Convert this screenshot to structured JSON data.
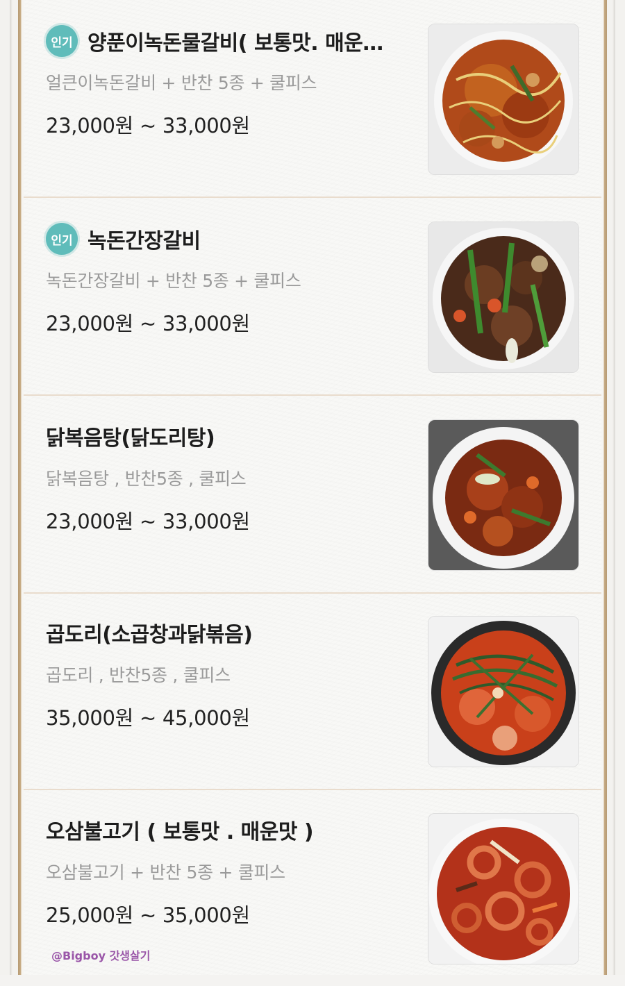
{
  "menu_items": [
    {
      "badge": "인기",
      "name": "양푼이녹돈물갈비( 보통맛. 매운…",
      "description": "얼큰이녹돈갈비 + 반찬 5종 + 쿨피스",
      "price": "23,000원 ~ 33,000원",
      "image": "spicy-pork-rib-stew-photo"
    },
    {
      "badge": "인기",
      "name": "녹돈간장갈비",
      "description": "녹돈간장갈비 + 반찬 5종 + 쿨피스",
      "price": "23,000원 ~ 33,000원",
      "image": "soy-sauce-pork-rib-photo"
    },
    {
      "name": "닭복음탕(닭도리탕)",
      "description": "닭복음탕 , 반찬5종  , 쿨피스",
      "price": "23,000원 ~ 33,000원",
      "image": "braised-spicy-chicken-photo"
    },
    {
      "name": "곱도리(소곱창과닭볶음)",
      "description": "곱도리 ,  반찬5종  , 쿨피스",
      "price": "35,000원 ~ 45,000원",
      "image": "beef-tripe-chicken-stir-fry-photo"
    },
    {
      "name": "오삼불고기 ( 보통맛 . 매운맛 )",
      "description": "오삼불고기 + 반찬 5종 + 쿨피스",
      "price": "25,000원 ~ 35,000원",
      "image": "squid-pork-bulgogi-photo"
    }
  ],
  "watermark": "@Bigboy 갓생살기",
  "colors": {
    "badge": "#5fbcba",
    "frame": "#c9ad86",
    "divider": "#e9dccd",
    "watermark": "#9a56a8"
  }
}
